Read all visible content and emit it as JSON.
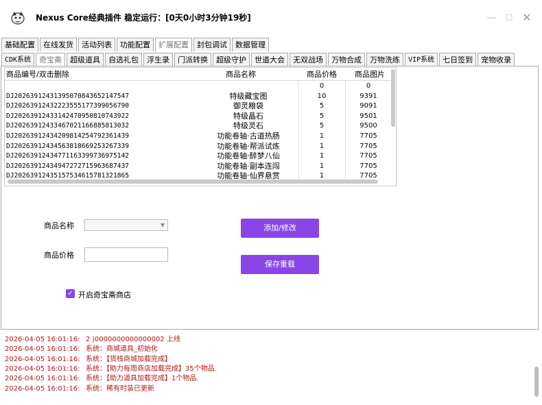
{
  "window": {
    "title": "Nexus Core经典插件  稳定运行：[0天0小时3分钟19秒]",
    "minimize_glyph": "—",
    "maximize_glyph": "☐",
    "close_glyph": "✕"
  },
  "tabs_top": [
    {
      "label": "基础配置",
      "active": false
    },
    {
      "label": "在线发货",
      "active": false
    },
    {
      "label": "活动列表",
      "active": false
    },
    {
      "label": "功能配置",
      "active": false
    },
    {
      "label": "扩展配置",
      "active": true
    },
    {
      "label": "封包调试",
      "active": false
    },
    {
      "label": "数据管理",
      "active": false
    }
  ],
  "tabs_sub": [
    {
      "label": "CDK系统",
      "active": false
    },
    {
      "label": "奇宝斋",
      "active": true
    },
    {
      "label": "超级道具",
      "active": false
    },
    {
      "label": "自选礼包",
      "active": false
    },
    {
      "label": "浮生录",
      "active": false
    },
    {
      "label": "门派转换",
      "active": false
    },
    {
      "label": "超级守护",
      "active": false
    },
    {
      "label": "世道大会",
      "active": false
    },
    {
      "label": "无双战场",
      "active": false
    },
    {
      "label": "万物合成",
      "active": false
    },
    {
      "label": "万物洗练",
      "active": false
    },
    {
      "label": "VIP系统",
      "active": false
    },
    {
      "label": "七日签到",
      "active": false
    },
    {
      "label": "宠物收录",
      "active": false
    }
  ],
  "table": {
    "headers": [
      "商品编号/双击删除",
      "商品名称",
      "商品价格",
      "商品图片"
    ],
    "rows": [
      [
        "",
        "",
        "0",
        "0"
      ],
      [
        "DJ20263912431395070843652147547",
        "特级藏宝图",
        "10",
        "9391"
      ],
      [
        "DJ20263912432223555177399056790",
        "御灵粮袋",
        "5",
        "9091"
      ],
      [
        "DJ20263912433142470950810743922",
        "特级晶石",
        "5",
        "9501"
      ],
      [
        "DJ20263912433467021166885813032",
        "特级灵石",
        "5",
        "9500"
      ],
      [
        "DJ20263912434209814254792361439",
        "功能卷轴·古道热肠",
        "1",
        "7705"
      ],
      [
        "DJ20263912434563818669253267339",
        "功能卷轴·帮派试炼",
        "1",
        "7705"
      ],
      [
        "DJ20263912434771163399736975142",
        "功能卷轴·醉梦八仙",
        "1",
        "7705"
      ],
      [
        "DJ20263912434947272715963687437",
        "功能卷轴·副本连闯",
        "1",
        "7705"
      ],
      [
        "DJ20263912435157534615781321865",
        "功能卷轴·仙界悬赏",
        "1",
        "7705"
      ]
    ]
  },
  "form": {
    "name_label": "商品名称",
    "name_value": "",
    "price_label": "商品价格",
    "price_value": "",
    "save_button": "添加/修改",
    "reload_button": "保存重载",
    "enable_checkbox_label": "开启奇宝斋商店",
    "enable_checked": true
  },
  "log": [
    {
      "time": "2026-04-05 16:01:16:",
      "message": "2 |0000000000000002    上线"
    },
    {
      "time": "2026-04-05 16:01:16:",
      "message": "系统：商城道具_初始化"
    },
    {
      "time": "2026-04-05 16:01:16:",
      "message": "系统：【货栈商城加载完成】"
    },
    {
      "time": "2026-04-05 16:01:16:",
      "message": "系统：【助力每周商店加载完成】35个物品."
    },
    {
      "time": "2026-04-05 16:01:16:",
      "message": "系统：【助力道具加载完成】1个物品."
    },
    {
      "time": "2026-04-05 16:01:16:",
      "message": "系统：稀有时装已更新"
    }
  ],
  "colors": {
    "accent": "#8a45e6",
    "log_text": "#b41616",
    "border": "#a9a9a9"
  }
}
